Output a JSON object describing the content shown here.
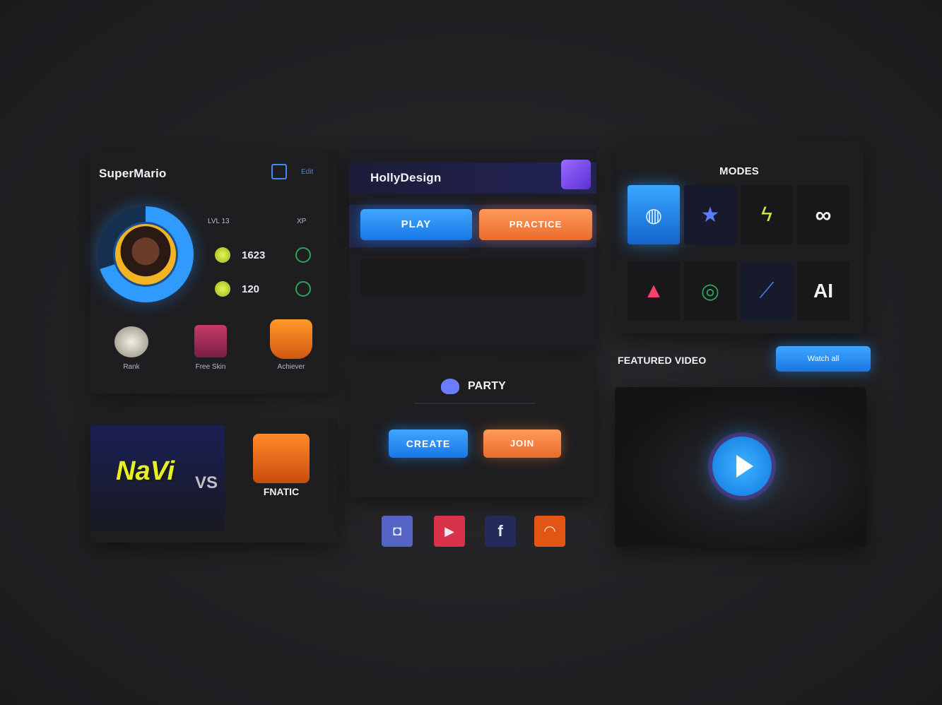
{
  "profile": {
    "username": "SuperMario",
    "level_label": "LVL 13",
    "xp_label": "XP",
    "coins": "1623",
    "gems": "120",
    "header_tag": "Edit",
    "badges": [
      {
        "label": "Rank"
      },
      {
        "label": "Free Skin"
      },
      {
        "label": "Achiever"
      }
    ]
  },
  "match": {
    "team_a": "NaVi",
    "vs": "VS",
    "team_b": "FNATIC"
  },
  "play_panel": {
    "title": "HollyDesign",
    "play_label": "PLAY",
    "practice_label": "PRACTICE"
  },
  "party": {
    "title": "PARTY",
    "create_label": "CREATE",
    "join_label": "JOIN"
  },
  "modes": {
    "title": "MODES",
    "ai_label": "AI",
    "infinity_label": "∞"
  },
  "featured": {
    "title": "FEATURED VIDEO",
    "watch_label": "Watch all"
  },
  "socials": [
    {
      "name": "discord-icon",
      "glyph": "◘",
      "color": "#6f7fd8"
    },
    {
      "name": "youtube-icon",
      "glyph": "▶",
      "color": "#e8344a"
    },
    {
      "name": "facebook-icon",
      "glyph": "f",
      "color": "#2a4aa8"
    },
    {
      "name": "reddit-icon",
      "glyph": "◠",
      "color": "#f05a1a"
    }
  ]
}
